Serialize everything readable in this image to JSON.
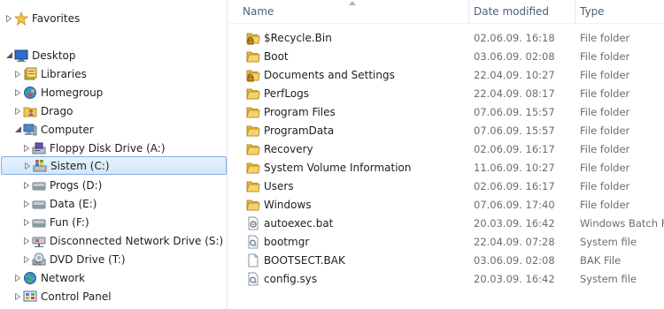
{
  "nav": {
    "items": [
      {
        "label": "Favorites",
        "icon": "star-icon",
        "indent": 0,
        "expander": "collapsed",
        "selected": false
      },
      {
        "label": "Desktop",
        "icon": "desktop-icon",
        "indent": 0,
        "expander": "expanded",
        "selected": false
      },
      {
        "label": "Libraries",
        "icon": "libraries-icon",
        "indent": 1,
        "expander": "collapsed",
        "selected": false
      },
      {
        "label": "Homegroup",
        "icon": "homegroup-icon",
        "indent": 1,
        "expander": "collapsed",
        "selected": false
      },
      {
        "label": "Drago",
        "icon": "user-folder-icon",
        "indent": 1,
        "expander": "collapsed",
        "selected": false
      },
      {
        "label": "Computer",
        "icon": "computer-icon",
        "indent": 1,
        "expander": "expanded",
        "selected": false
      },
      {
        "label": "Floppy Disk Drive (A:)",
        "icon": "floppy-drive-icon",
        "indent": 2,
        "expander": "collapsed",
        "selected": false
      },
      {
        "label": "Sistem (C:)",
        "icon": "windows-drive-icon",
        "indent": 2,
        "expander": "collapsed",
        "selected": true
      },
      {
        "label": "Progs (D:)",
        "icon": "hard-drive-icon",
        "indent": 2,
        "expander": "collapsed",
        "selected": false
      },
      {
        "label": "Data (E:)",
        "icon": "hard-drive-icon",
        "indent": 2,
        "expander": "collapsed",
        "selected": false
      },
      {
        "label": "Fun (F:)",
        "icon": "hard-drive-icon",
        "indent": 2,
        "expander": "collapsed",
        "selected": false
      },
      {
        "label": "Disconnected Network Drive (S:)",
        "icon": "network-drive-icon",
        "indent": 2,
        "expander": "collapsed",
        "selected": false
      },
      {
        "label": "DVD Drive (T:)",
        "icon": "dvd-drive-icon",
        "indent": 2,
        "expander": "collapsed",
        "selected": false
      },
      {
        "label": "Network",
        "icon": "network-icon",
        "indent": 1,
        "expander": "collapsed",
        "selected": false
      },
      {
        "label": "Control Panel",
        "icon": "control-panel-icon",
        "indent": 1,
        "expander": "collapsed",
        "selected": false
      }
    ]
  },
  "list": {
    "sort_column": "name",
    "columns": {
      "name": "Name",
      "date": "Date modified",
      "type": "Type"
    },
    "rows": [
      {
        "name": "$Recycle.Bin",
        "date": "02.06.09. 16:18",
        "type": "File folder",
        "icon": "locked-folder-icon"
      },
      {
        "name": "Boot",
        "date": "03.06.09. 02:08",
        "type": "File folder",
        "icon": "folder-icon"
      },
      {
        "name": "Documents and Settings",
        "date": "22.04.09. 10:27",
        "type": "File folder",
        "icon": "locked-folder-icon"
      },
      {
        "name": "PerfLogs",
        "date": "22.04.09. 08:17",
        "type": "File folder",
        "icon": "folder-icon"
      },
      {
        "name": "Program Files",
        "date": "07.06.09. 15:57",
        "type": "File folder",
        "icon": "folder-icon"
      },
      {
        "name": "ProgramData",
        "date": "07.06.09. 15:57",
        "type": "File folder",
        "icon": "folder-icon"
      },
      {
        "name": "Recovery",
        "date": "02.06.09. 16:17",
        "type": "File folder",
        "icon": "folder-icon"
      },
      {
        "name": "System Volume Information",
        "date": "11.06.09. 10:27",
        "type": "File folder",
        "icon": "folder-icon"
      },
      {
        "name": "Users",
        "date": "02.06.09. 16:17",
        "type": "File folder",
        "icon": "folder-icon"
      },
      {
        "name": "Windows",
        "date": "07.06.09. 17:40",
        "type": "File folder",
        "icon": "folder-icon"
      },
      {
        "name": "autoexec.bat",
        "date": "20.03.09. 16:42",
        "type": "Windows Batch Fi",
        "icon": "batch-file-icon"
      },
      {
        "name": "bootmgr",
        "date": "22.04.09. 07:28",
        "type": "System file",
        "icon": "system-file-icon"
      },
      {
        "name": "BOOTSECT.BAK",
        "date": "03.06.09. 02:08",
        "type": "BAK File",
        "icon": "blank-file-icon"
      },
      {
        "name": "config.sys",
        "date": "20.03.09. 16:42",
        "type": "System file",
        "icon": "system-file-icon"
      }
    ]
  },
  "colors": {
    "selection_bg": "#d3e8fb",
    "selection_border": "#84acdd",
    "folder": "#f2c84b",
    "header_text": "#4c607a",
    "secondary_text": "#6d6d6d"
  }
}
